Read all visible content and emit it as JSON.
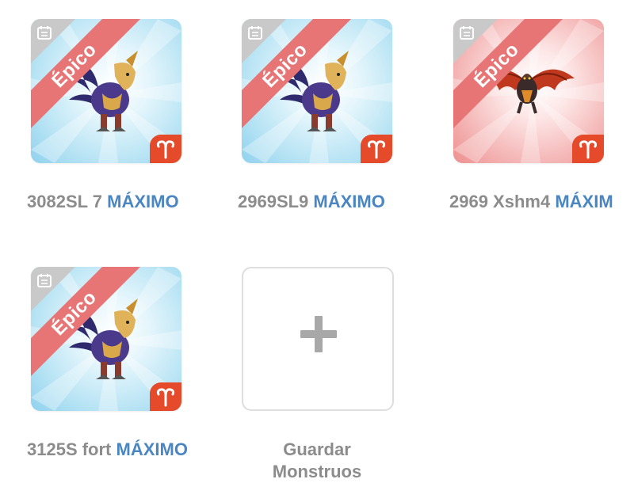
{
  "monsters": [
    {
      "name": "3082SL 7",
      "level": "MÁXIMO",
      "rarity": "Épico",
      "theme": "blue",
      "creature_icon": "armored-bird-monster",
      "element_icon": "aries-icon"
    },
    {
      "name": "2969SL9",
      "level": "MÁXIMO",
      "rarity": "Épico",
      "theme": "blue",
      "creature_icon": "armored-bird-monster",
      "element_icon": "aries-icon"
    },
    {
      "name": "2969 Xshm4",
      "level": "MÁXIM",
      "rarity": "Épico",
      "theme": "red",
      "creature_icon": "winged-dragon-monster",
      "element_icon": "aries-icon"
    },
    {
      "name": "3125S fort",
      "level": "MÁXIMO",
      "rarity": "Épico",
      "theme": "blue",
      "creature_icon": "armored-bird-monster",
      "element_icon": "aries-icon"
    }
  ],
  "add_slot": {
    "label_line1": "Guardar",
    "label_line2": "Monstruos",
    "icon": "plus-icon"
  },
  "colors": {
    "max_text": "#4a86c2",
    "label_text": "#8c8c8c",
    "ribbon": "#e87575",
    "badge": "#e54a2a"
  }
}
